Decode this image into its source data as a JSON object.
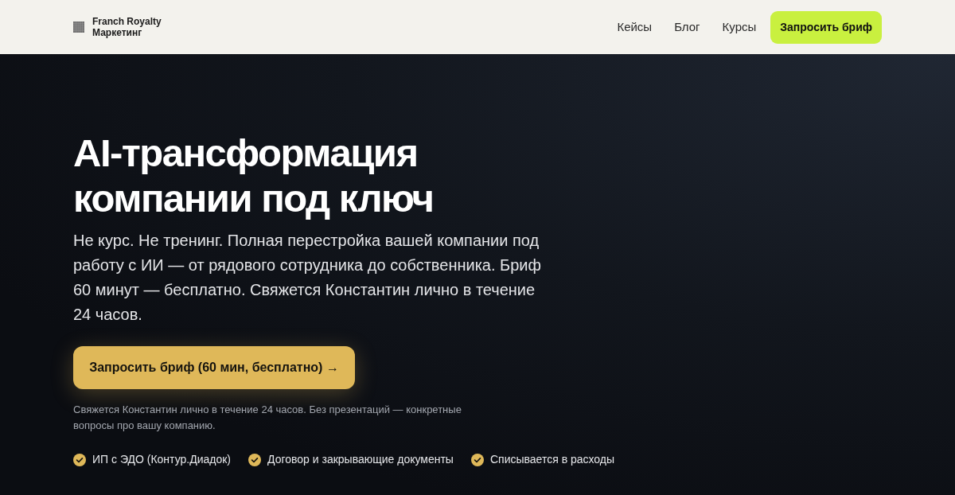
{
  "header": {
    "logo": {
      "line_1": "Franch Royalty",
      "line_2": "Маркетинг"
    },
    "nav": [
      {
        "label": "Кейсы"
      },
      {
        "label": "Блог"
      },
      {
        "label": "Курсы"
      }
    ],
    "cta": "Запросить бриф"
  },
  "hero": {
    "title": "AI-трансформация компании под ключ",
    "lead": "Не курс. Не тренинг. Полная перестройка вашей компании под работу с ИИ — от рядового сотрудника до собственника. Бриф 60 минут — бесплатно. Свяжется Константин лично в течение 24 часов.",
    "button": "Запросить бриф (60 мин, бесплатно) →",
    "note": "Свяжется Константин лично в течение 24 часов. Без презентаций — конкретные вопросы про вашу компанию.",
    "features": [
      "ИП с ЭДО (Контур.Диадок)",
      "Договор и закрывающие документы",
      "Списывается в расходы"
    ]
  }
}
